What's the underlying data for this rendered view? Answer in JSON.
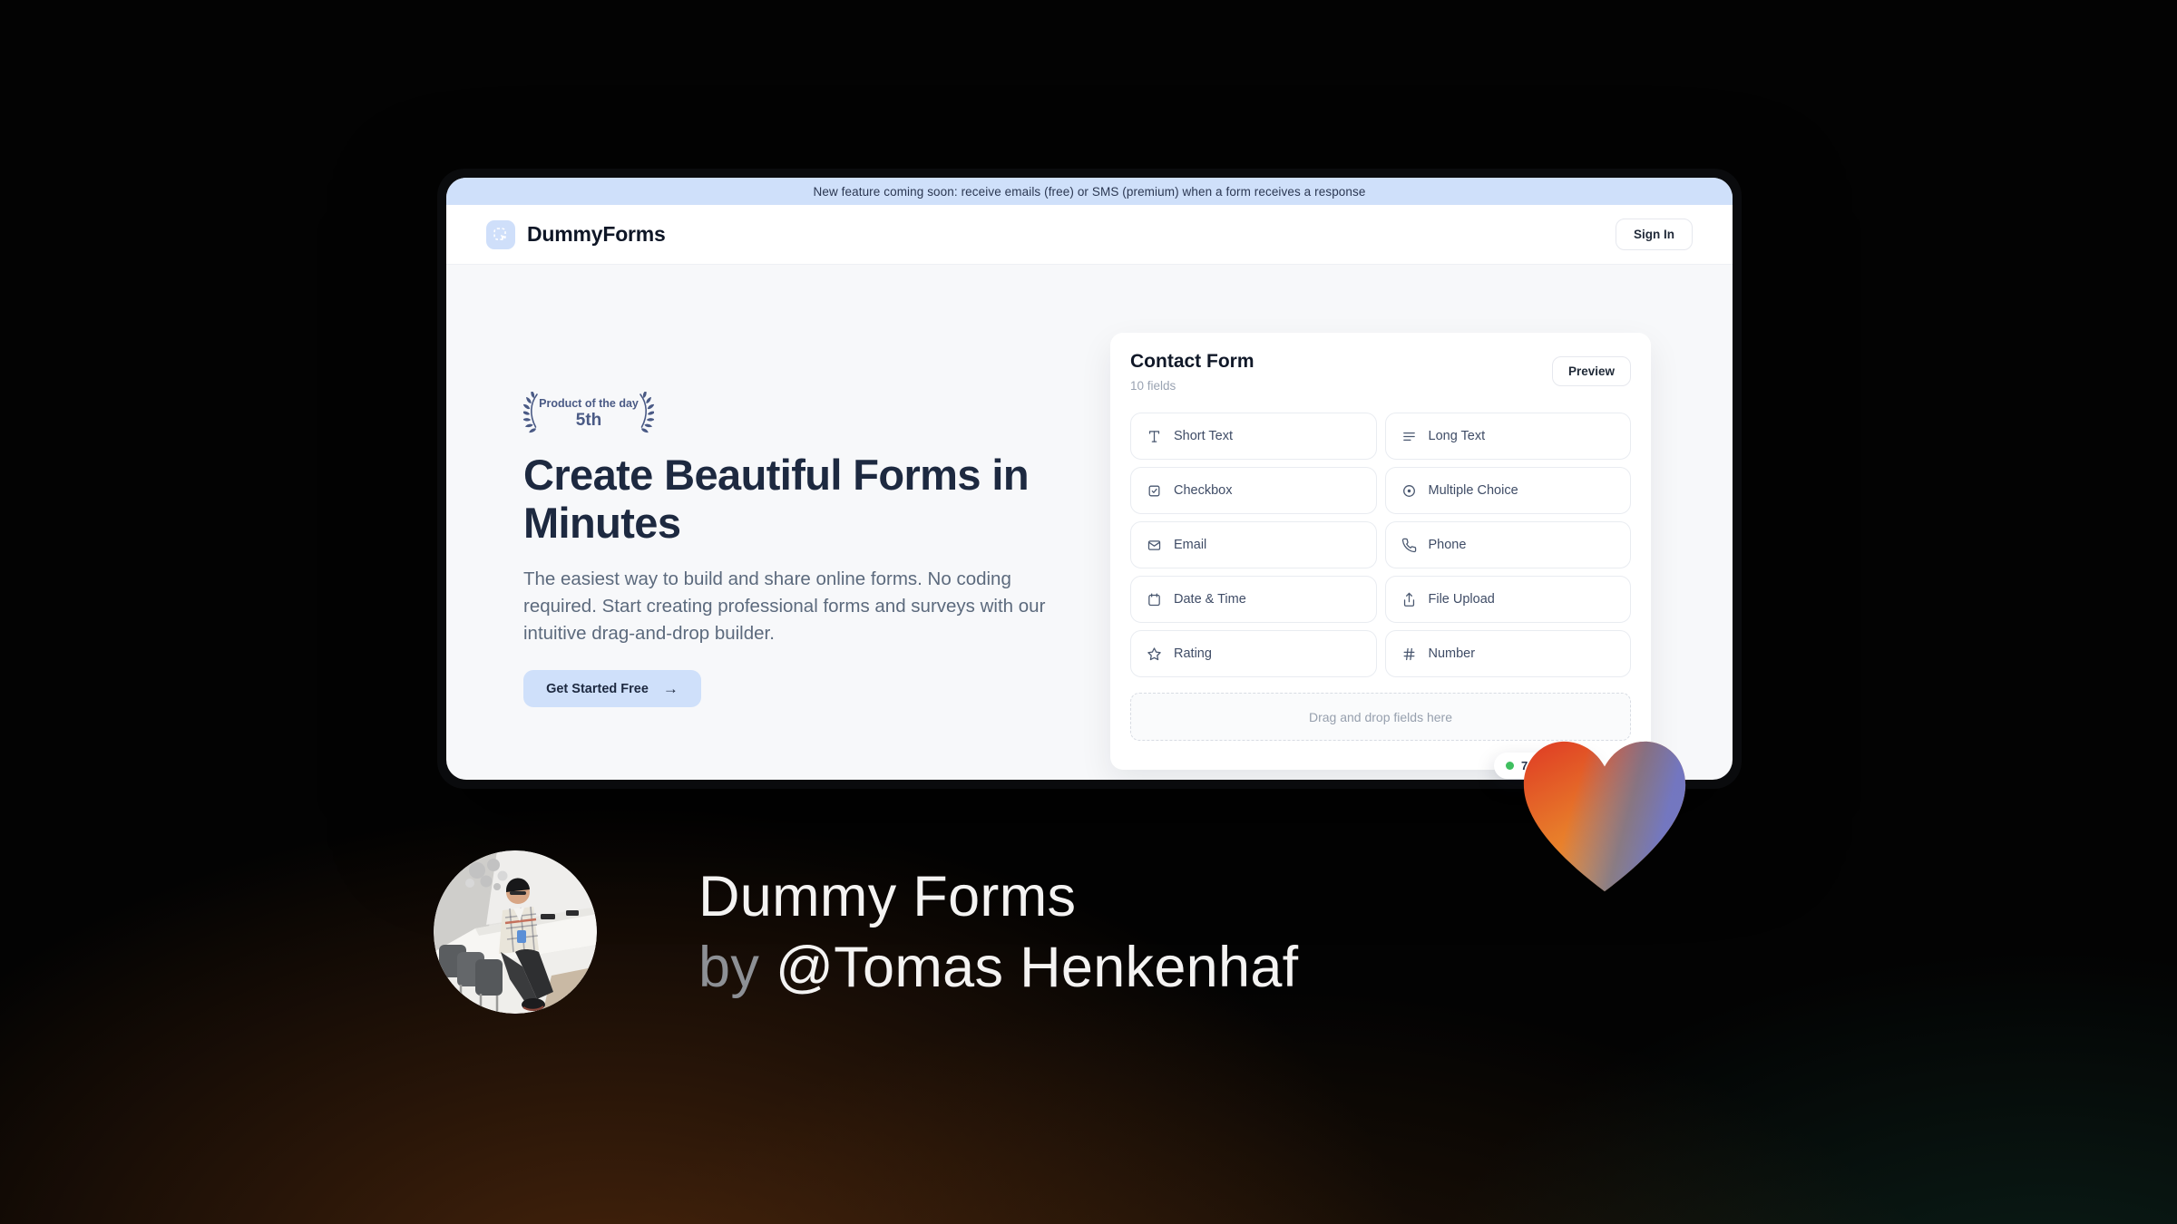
{
  "banner": {
    "text": "New feature coming soon: receive emails (free) or SMS (premium) when a form receives a response"
  },
  "header": {
    "brand": "DummyForms",
    "sign_in_label": "Sign In"
  },
  "hero": {
    "award_line1": "Product of the day",
    "award_line2": "5th",
    "title": "Create Beautiful Forms in Minutes",
    "description": "The easiest way to build and share online forms. No coding required. Start creating professional forms and surveys with our intuitive drag-and-drop builder.",
    "cta_label": "Get Started Free",
    "cta_arrow": "→"
  },
  "form_card": {
    "title": "Contact Form",
    "subtitle": "10 fields",
    "preview_label": "Preview",
    "fields": [
      {
        "label": "Short Text",
        "icon": "type-icon"
      },
      {
        "label": "Long Text",
        "icon": "lines-icon"
      },
      {
        "label": "Checkbox",
        "icon": "checkbox-icon"
      },
      {
        "label": "Multiple Choice",
        "icon": "radio-icon"
      },
      {
        "label": "Email",
        "icon": "mail-icon"
      },
      {
        "label": "Phone",
        "icon": "phone-icon"
      },
      {
        "label": "Date & Time",
        "icon": "calendar-icon"
      },
      {
        "label": "File Upload",
        "icon": "upload-icon"
      },
      {
        "label": "Rating",
        "icon": "star-icon"
      },
      {
        "label": "Number",
        "icon": "hash-icon"
      }
    ],
    "dropzone_text": "Drag and drop fields here",
    "toast": {
      "text": "7"
    }
  },
  "caption": {
    "line1": "Dummy Forms",
    "by": "by ",
    "name": "@Tomas Henkenhaf"
  },
  "colors": {
    "accent_blue": "#cfe0fa",
    "banner_bg": "#cfe0fa",
    "award_navy": "#4a5a85",
    "toast_green": "#3fbf5f",
    "heart_red": "#e03a24",
    "heart_orange": "#f2a133",
    "heart_blue": "#6d76c8"
  }
}
